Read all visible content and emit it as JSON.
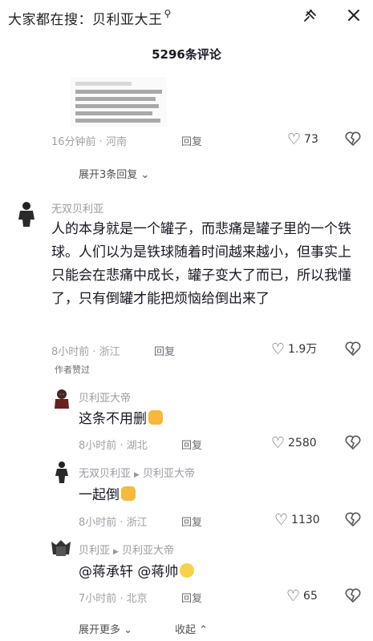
{
  "top": {
    "search_hint": "大家都在搜：贝利亚大王",
    "search_hint_icon": "search-icon",
    "pin_icon": "pin-icon",
    "close_icon": "close-icon"
  },
  "comment_count": "5296条评论",
  "prev_comment": {
    "meta": "16分钟前 · 河南",
    "reply": "回复",
    "likes": "73",
    "expand": "展开3条回复"
  },
  "main_comment": {
    "username": "无双贝利亚",
    "text": "人的本身就是一个罐子，而悲痛是罐子里的一个铁球。人们以为是铁球随着时间越来越小，但事实上只能会在悲痛中成长，罐子变大了而已，所以我懂了，只有倒罐才能把烦恼给倒出来了",
    "meta": "8小时前 · 浙江",
    "reply": "回复",
    "likes": "1.9万",
    "author_liked": "作者赞过"
  },
  "replies": [
    {
      "username": "贝利亚大帝",
      "reply_to": "",
      "text": "这条不用删",
      "meta": "8小时前 · 湖北",
      "reply": "回复",
      "likes": "2580"
    },
    {
      "username": "无双贝利亚",
      "reply_to": "贝利亚大帝",
      "text": "一起倒",
      "meta": "8小时前 · 浙江",
      "reply": "回复",
      "likes": "1130"
    },
    {
      "username": "贝利亚",
      "reply_to": "贝利亚大帝",
      "text": "@蒋承轩 @蒋帅",
      "meta": "7小时前 · 北京",
      "reply": "回复",
      "likes": "65"
    }
  ],
  "footer": {
    "expand_more": "展开更多",
    "collapse": "收起"
  },
  "colors": {
    "text": "#161823",
    "meta": "#a0a0a8",
    "emoji": "#f6b93b"
  }
}
